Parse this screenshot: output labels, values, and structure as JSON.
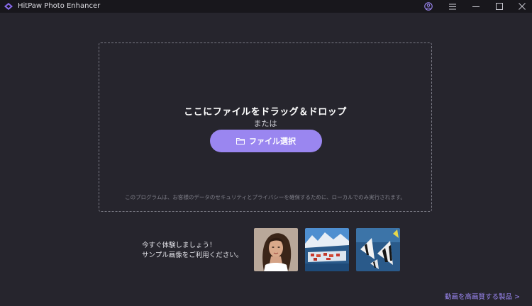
{
  "window": {
    "title": "HitPaw Photo Enhancer",
    "icons": [
      "account-icon",
      "menu-icon",
      "minimize-icon",
      "maximize-icon",
      "close-icon"
    ]
  },
  "dropzone": {
    "title": "ここにファイルをドラッグ＆ドロップ",
    "or_text": "または",
    "button_label": "ファイル選択",
    "button_icon": "folder-icon",
    "privacy_note": "このプログラムは、お客様のデータのセキュリティとプライバシーを確保するために、ローカルでのみ実行されます。"
  },
  "samples": {
    "line1": "今すぐ体験しましょう！",
    "line2": "サンプル画像をご利用ください。",
    "images": [
      "woman-portrait",
      "snowy-village",
      "angelfish"
    ]
  },
  "footer": {
    "link_text": "動画を高画質する製品 >"
  },
  "colors": {
    "background": "#26252d",
    "titlebar": "#18171c",
    "accent": "#9a86f0",
    "dashed_border": "#7a7a85"
  }
}
